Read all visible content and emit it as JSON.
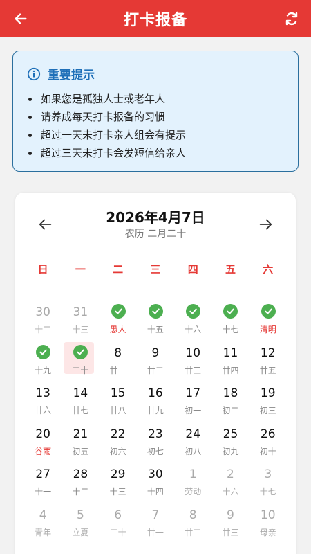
{
  "header": {
    "title": "打卡报备",
    "bg": "#e53935"
  },
  "notice": {
    "title": "重要提示",
    "items": [
      "如果您是孤独人士或老年人",
      "请养成每天打卡报备的习惯",
      "超过一天未打卡亲人组会有提示",
      "超过三天未打卡会发短信给亲人"
    ]
  },
  "calendar": {
    "date_title": "2026年4月7日",
    "lunar_title": "农历 二月二十",
    "weekdays": [
      "日",
      "一",
      "二",
      "三",
      "四",
      "五",
      "六"
    ],
    "rows": [
      [
        {
          "day": "30",
          "lunar": "十二",
          "other": true,
          "checked": false
        },
        {
          "day": "31",
          "lunar": "十三",
          "other": true,
          "checked": false
        },
        {
          "day": "1",
          "lunar": "愚人",
          "checked": true,
          "festival": true
        },
        {
          "day": "2",
          "lunar": "十五",
          "checked": true
        },
        {
          "day": "3",
          "lunar": "十六",
          "checked": true
        },
        {
          "day": "4",
          "lunar": "十七",
          "checked": true
        },
        {
          "day": "5",
          "lunar": "清明",
          "checked": true,
          "festival": true
        }
      ],
      [
        {
          "day": "6",
          "lunar": "十九",
          "checked": true
        },
        {
          "day": "7",
          "lunar": "二十",
          "checked": true,
          "today": true
        },
        {
          "day": "8",
          "lunar": "廿一"
        },
        {
          "day": "9",
          "lunar": "廿二"
        },
        {
          "day": "10",
          "lunar": "廿三"
        },
        {
          "day": "11",
          "lunar": "廿四"
        },
        {
          "day": "12",
          "lunar": "廿五"
        }
      ],
      [
        {
          "day": "13",
          "lunar": "廿六"
        },
        {
          "day": "14",
          "lunar": "廿七"
        },
        {
          "day": "15",
          "lunar": "廿八"
        },
        {
          "day": "16",
          "lunar": "廿九"
        },
        {
          "day": "17",
          "lunar": "初一"
        },
        {
          "day": "18",
          "lunar": "初二"
        },
        {
          "day": "19",
          "lunar": "初三"
        }
      ],
      [
        {
          "day": "20",
          "lunar": "谷雨",
          "festival": true
        },
        {
          "day": "21",
          "lunar": "初五"
        },
        {
          "day": "22",
          "lunar": "初六"
        },
        {
          "day": "23",
          "lunar": "初七"
        },
        {
          "day": "24",
          "lunar": "初八"
        },
        {
          "day": "25",
          "lunar": "初九"
        },
        {
          "day": "26",
          "lunar": "初十"
        }
      ],
      [
        {
          "day": "27",
          "lunar": "十一"
        },
        {
          "day": "28",
          "lunar": "十二"
        },
        {
          "day": "29",
          "lunar": "十三"
        },
        {
          "day": "30",
          "lunar": "十四"
        },
        {
          "day": "1",
          "lunar": "劳动",
          "other": true
        },
        {
          "day": "2",
          "lunar": "十六",
          "other": true
        },
        {
          "day": "3",
          "lunar": "十七",
          "other": true
        }
      ],
      [
        {
          "day": "4",
          "lunar": "青年",
          "other": true
        },
        {
          "day": "5",
          "lunar": "立夏",
          "other": true
        },
        {
          "day": "6",
          "lunar": "二十",
          "other": true
        },
        {
          "day": "7",
          "lunar": "廿一",
          "other": true
        },
        {
          "day": "8",
          "lunar": "廿二",
          "other": true
        },
        {
          "day": "9",
          "lunar": "廿三",
          "other": true
        },
        {
          "day": "10",
          "lunar": "母亲",
          "other": true
        }
      ]
    ]
  },
  "colors": {
    "accent": "#e53935",
    "check": "#4caf50",
    "info": "#1e6fb8"
  }
}
